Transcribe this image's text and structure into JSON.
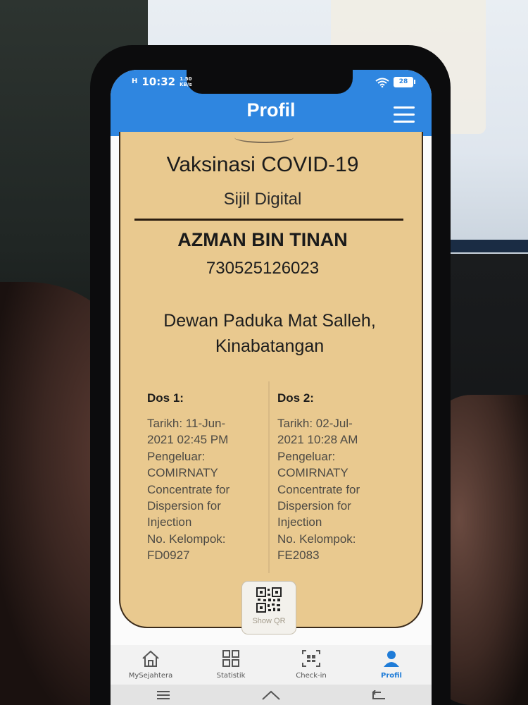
{
  "status_bar": {
    "signal": "H",
    "time": "10:32",
    "speed_value": "1.50",
    "speed_unit": "KB/s",
    "battery": "28"
  },
  "header": {
    "title": "Profil",
    "menu_icon": "hamburger-menu-icon"
  },
  "certificate": {
    "title": "Vaksinasi COVID-19",
    "subtitle": "Sijil Digital",
    "name": "AZMAN BIN TINAN",
    "ic_number": "730525126023",
    "place_line1": "Dewan Paduka Mat Salleh,",
    "place_line2": "Kinabatangan",
    "doses": [
      {
        "heading": "Dos 1:",
        "date_line1": "Tarikh: 11-Jun-",
        "date_line2": "2021 02:45 PM",
        "manufacturer_label": "Pengeluar:",
        "vaccine_line1": "COMIRNATY",
        "vaccine_line2": "Concentrate for",
        "vaccine_line3": "Dispersion for",
        "vaccine_line4": "Injection",
        "batch_label": "No. Kelompok:",
        "batch": "FD0927"
      },
      {
        "heading": "Dos 2:",
        "date_line1": "Tarikh: 02-Jul-",
        "date_line2": "2021 10:28 AM",
        "manufacturer_label": "Pengeluar:",
        "vaccine_line1": "COMIRNATY",
        "vaccine_line2": "Concentrate for",
        "vaccine_line3": "Dispersion for",
        "vaccine_line4": "Injection",
        "batch_label": "No. Kelompok:",
        "batch": "FE2083"
      }
    ],
    "qr_button_label": "Show QR"
  },
  "bottom_nav": [
    {
      "label": "MySejahtera",
      "icon": "home-icon"
    },
    {
      "label": "Statistik",
      "icon": "grid-icon"
    },
    {
      "label": "Check-in",
      "icon": "qr-scan-icon"
    },
    {
      "label": "Profil",
      "icon": "person-icon",
      "active": true
    }
  ],
  "colors": {
    "header_blue": "#2f86e0",
    "card_tan": "#e9c98f",
    "active_nav": "#1f7cd8"
  }
}
